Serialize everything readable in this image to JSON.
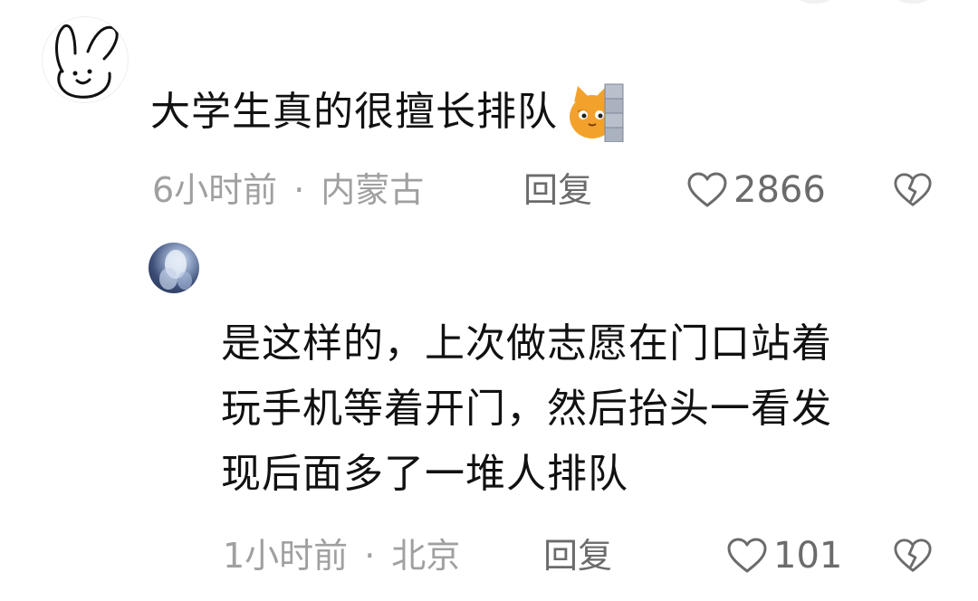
{
  "colors": {
    "meta_text": "#a0a0a0",
    "action_text": "#6b6b6b",
    "body_text": "#111111",
    "background": "#ffffff"
  },
  "main_comment": {
    "avatar_icon": "bunny-doodle-icon",
    "text": "大学生真的很擅长排队",
    "emoji": "peeking-cat-emoji",
    "time": "6小时前",
    "separator": "·",
    "location": "内蒙古",
    "reply_label": "回复",
    "likes": "2866",
    "like_icon": "heart-outline-icon",
    "dislike_icon": "broken-heart-icon"
  },
  "reply_comment": {
    "avatar_icon": "user-avatar-photo",
    "lines": [
      "是这样的，上次做志愿在门口站着",
      "玩手机等着开门，然后抬头一看发",
      "现后面多了一堆人排队"
    ],
    "time": "1小时前",
    "separator": "·",
    "location": "北京",
    "reply_label": "回复",
    "likes": "101",
    "like_icon": "heart-outline-icon",
    "dislike_icon": "broken-heart-icon"
  }
}
